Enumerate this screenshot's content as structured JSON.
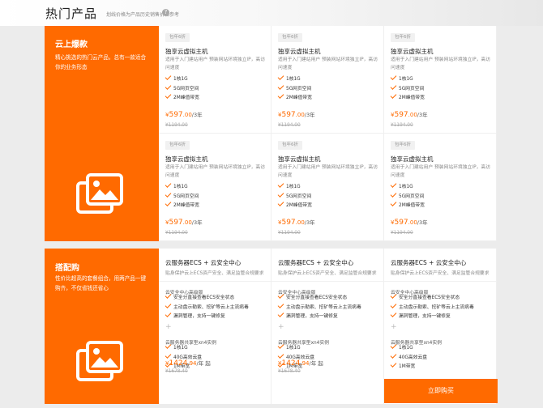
{
  "header": {
    "title": "热门产品",
    "subtitle": "划线价格为产品历史销售价格参考",
    "help_glyph": "?"
  },
  "cloud": {
    "title": "云上爆款",
    "desc": "精心挑选的热门云产品，总有一款适合你的业务形态",
    "icon": "images-icon"
  },
  "bundle": {
    "title": "搭配购",
    "desc": "性价比超高的套餐组合，用两产品一键购齐，不仅省钱还省心",
    "icon": "images-icon",
    "buy": "立即购买"
  },
  "products": [
    {
      "badge": "包年6折",
      "title": "独享云虚拟主机",
      "desc": "适用于入门建站用户 预装网站环境独立IP，高访问速度",
      "features": [
        "1核1G",
        "5G网页空间",
        "2M峰值带宽"
      ],
      "currency": "¥",
      "price": "597",
      "decimal": ".00",
      "unit": "/3年",
      "orig": "¥1194.00"
    },
    {
      "badge": "包年6折",
      "title": "独享云虚拟主机",
      "desc": "适用于入门建站用户 预装网站环境独立IP，高访问速度",
      "features": [
        "1核1G",
        "5G网页空间",
        "2M峰值带宽"
      ],
      "currency": "¥",
      "price": "597",
      "decimal": ".00",
      "unit": "/3年",
      "orig": "¥1194.00"
    },
    {
      "badge": "包年6折",
      "title": "独享云虚拟主机",
      "desc": "适用于入门建站用户 预装网站环境独立IP，高访问速度",
      "features": [
        "1核1G",
        "5G网页空间",
        "2M峰值带宽"
      ],
      "currency": "¥",
      "price": "597",
      "decimal": ".00",
      "unit": "/3年",
      "orig": "¥1194.00"
    },
    {
      "badge": "包年6折",
      "title": "独享云虚拟主机",
      "desc": "适用于入门建站用户 预装网站环境独立IP，高访问速度",
      "features": [
        "1核1G",
        "5G网页空间",
        "2M峰值带宽"
      ],
      "currency": "¥",
      "price": "597",
      "decimal": ".00",
      "unit": "/3年",
      "orig": "¥1194.00"
    },
    {
      "badge": "包年6折",
      "title": "独享云虚拟主机",
      "desc": "适用于入门建站用户 预装网站环境独立IP，高访问速度",
      "features": [
        "1核1G",
        "5G网页空间",
        "2M峰值带宽"
      ],
      "currency": "¥",
      "price": "597",
      "decimal": ".00",
      "unit": "/3年",
      "orig": "¥1194.00"
    },
    {
      "badge": "包年6折",
      "title": "独享云虚拟主机",
      "desc": "适用于入门建站用户 预装网站环境独立IP，高访问速度",
      "features": [
        "1核1G",
        "5G网页空间",
        "2M峰值带宽"
      ],
      "currency": "¥",
      "price": "597",
      "decimal": ".00",
      "unit": "/3年",
      "orig": "¥1194.00"
    }
  ],
  "bundles": [
    {
      "title": "云服务器ECS + 云安全中心",
      "desc": "贴身保护云上ECS资产安全、满足监管合规要求",
      "group1": "云安全中心高级版",
      "sec": [
        "安全分直接查看ECS安全状态",
        "主动盘示勒索、挖矿等云上主流病毒",
        "漏洞管理，支持一键修复"
      ],
      "plus": "+",
      "group2": "云服务器共享型xn4实例",
      "cfg": [
        "1核1G",
        "40G高效云盘",
        "1M带宽"
      ],
      "currency": "¥",
      "price": "1424",
      "decimal": ".94",
      "unit": "/年 起",
      "orig": "¥1678.40"
    },
    {
      "title": "云服务器ECS + 云安全中心",
      "desc": "贴身保护云上ECS资产安全、满足监管合规要求",
      "group1": "云安全中心高级版",
      "sec": [
        "安全分直接查看ECS安全状态",
        "主动盘示勒索、挖矿等云上主流病毒",
        "漏洞管理，支持一键修复"
      ],
      "plus": "+",
      "group2": "云服务器共享型xn4实例",
      "cfg": [
        "1核1G",
        "40G高效云盘",
        "1M带宽"
      ],
      "currency": "¥",
      "price": "1424",
      "decimal": ".94",
      "unit": "/年 起",
      "orig": "¥1678.40"
    },
    {
      "title": "云服务器ECS + 云安全中心",
      "desc": "贴身保护云上ECS资产安全、满足监管合规要求",
      "group1": "云安全中心高级版",
      "sec": [
        "安全分直接查看ECS安全状态",
        "主动盘示勒索、挖矿等云上主流病毒",
        "漏洞管理，支持一键修复"
      ],
      "plus": "+",
      "group2": "云服务器共享型xn4实例",
      "cfg": [
        "1核1G",
        "40G高效云盘",
        "1M带宽"
      ]
    }
  ],
  "colors": {
    "accent": "#ff6a00",
    "page_bg": "#ececec",
    "card_bg": "#ffffff"
  }
}
